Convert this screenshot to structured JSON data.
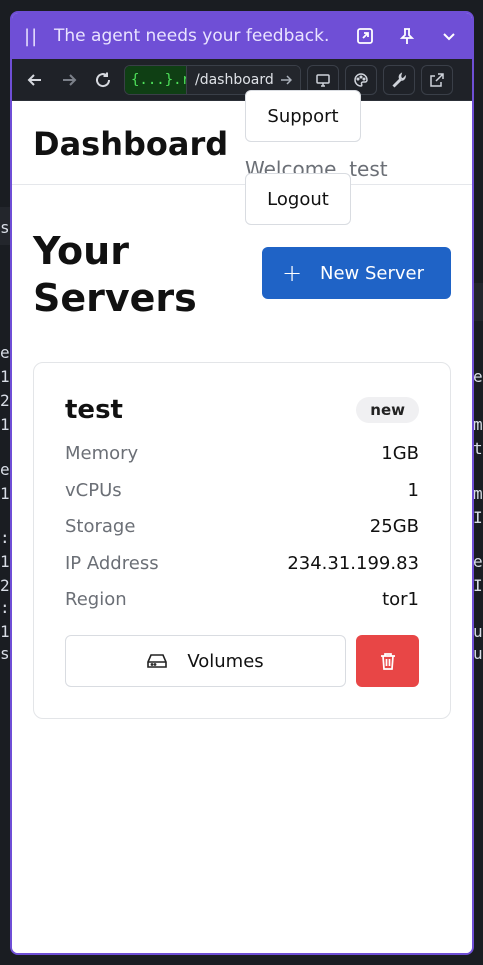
{
  "banner": {
    "message": "The agent needs your feedback.",
    "icons": [
      "pause-icon",
      "expand-icon",
      "pin-icon",
      "chevron-down-icon"
    ]
  },
  "browser": {
    "domain_text": "{...}.rep",
    "path_text": "/dashboard",
    "tools": [
      "monitor-icon",
      "palette-icon",
      "wrench-icon",
      "external-link-icon"
    ]
  },
  "header": {
    "title": "Dashboard",
    "support_label": "Support",
    "welcome_text": "Welcome, test",
    "logout_label": "Logout"
  },
  "servers": {
    "heading": "Your Servers",
    "new_label": "New Server"
  },
  "server_card": {
    "name": "test",
    "badge": "new",
    "specs": [
      {
        "label": "Memory",
        "value": "1GB"
      },
      {
        "label": "vCPUs",
        "value": "1"
      },
      {
        "label": "Storage",
        "value": "25GB"
      },
      {
        "label": "IP Address",
        "value": "234.31.199.83"
      },
      {
        "label": "Region",
        "value": "tor1"
      }
    ],
    "volumes_label": "Volumes"
  },
  "colors": {
    "banner": "#6f4fd6",
    "primary": "#1f63c6",
    "danger": "#e84646"
  }
}
